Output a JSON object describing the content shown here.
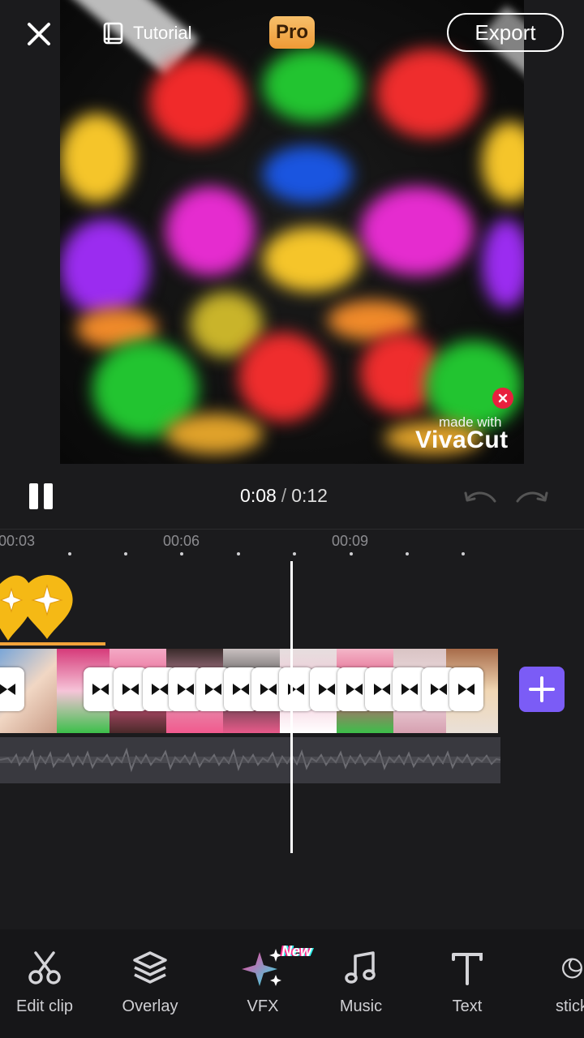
{
  "top_bar": {
    "tutorial_label": "Tutorial",
    "pro_label": "Pro",
    "export_label": "Export"
  },
  "watermark": {
    "line1": "made with",
    "line2": "VivaCut"
  },
  "playback": {
    "current_time": "0:08",
    "separator": "/",
    "total_time": "0:12"
  },
  "timeline": {
    "ruler_labels": [
      "00:03",
      "00:06",
      "00:09"
    ],
    "playhead_time": "0:08"
  },
  "toolbar": {
    "items": [
      {
        "label": "Edit clip",
        "icon": "scissors-icon"
      },
      {
        "label": "Overlay",
        "icon": "layers-icon"
      },
      {
        "label": "VFX",
        "icon": "sparkle-icon"
      },
      {
        "label": "Music",
        "icon": "music-note-icon"
      },
      {
        "label": "Text",
        "icon": "text-icon"
      },
      {
        "label": "stick",
        "icon": "sticker-icon"
      }
    ],
    "new_badge": "New"
  },
  "colors": {
    "accent_purple": "#7b5cf6",
    "pro_orange": "#f2a33a",
    "watermark_close_red": "#e8203e",
    "background": "#1b1b1d"
  }
}
